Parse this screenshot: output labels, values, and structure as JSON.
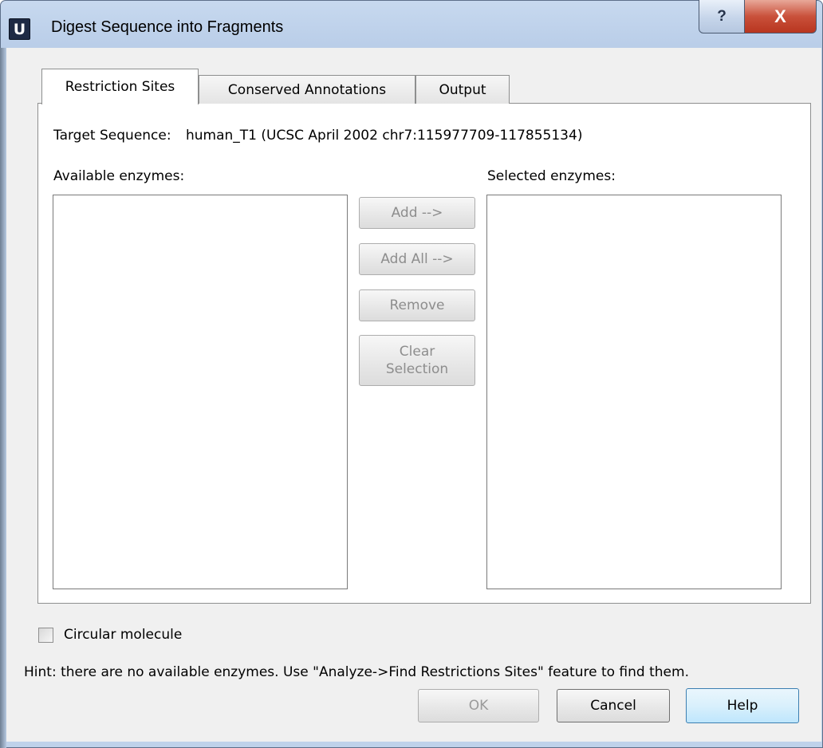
{
  "window": {
    "title": "Digest Sequence into Fragments",
    "app_icon_letter": "U",
    "help_glyph": "?",
    "close_glyph": "X"
  },
  "tabs": [
    {
      "label": "Restriction Sites",
      "active": true
    },
    {
      "label": "Conserved Annotations",
      "active": false
    },
    {
      "label": "Output",
      "active": false
    }
  ],
  "restriction_sites": {
    "target_label": "Target Sequence:",
    "target_value": "human_T1 (UCSC April 2002 chr7:115977709-117855134)",
    "available_label": "Available enzymes:",
    "selected_label": "Selected enzymes:",
    "available_items": [],
    "selected_items": [],
    "buttons": {
      "add": "Add -->",
      "add_all": "Add All -->",
      "remove": "Remove",
      "clear": "Clear\nSelection"
    }
  },
  "options": {
    "circular_label": "Circular molecule",
    "circular_checked": false
  },
  "hint": "Hint: there are no available enzymes. Use \"Analyze->Find Restrictions Sites\" feature to find them.",
  "footer": {
    "ok": "OK",
    "cancel": "Cancel",
    "help": "Help"
  }
}
